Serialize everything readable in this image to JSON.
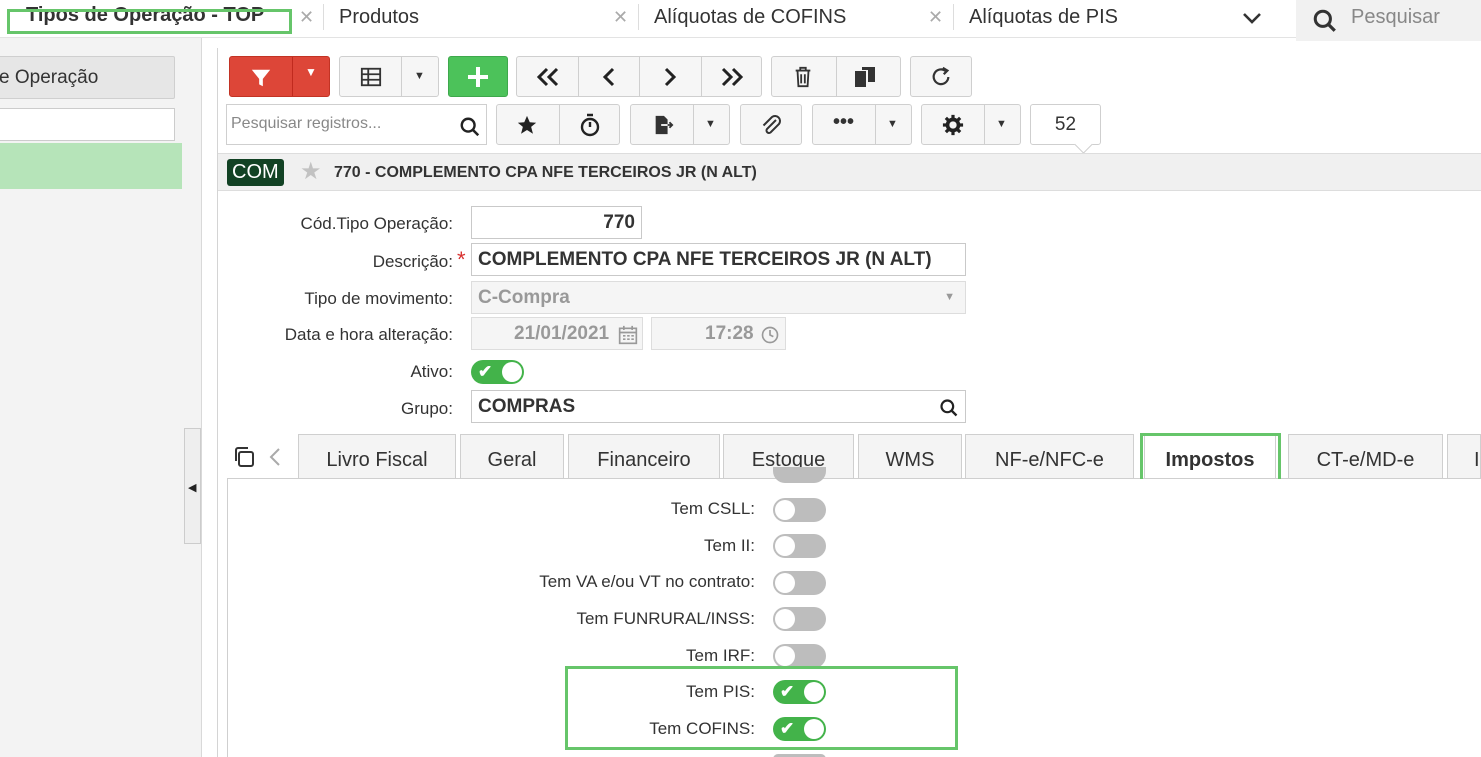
{
  "top_tabs": [
    {
      "label": "Tipos de Operação - TOP"
    },
    {
      "label": "Produtos"
    },
    {
      "label": "Alíquotas de COFINS"
    },
    {
      "label": "Alíquotas de PIS"
    }
  ],
  "top_search_placeholder": "Pesquisar",
  "sidebar": {
    "button_label": "e Operação"
  },
  "toolbar": {
    "search_placeholder": "Pesquisar registros...",
    "record_count": "52"
  },
  "record": {
    "badge": "COM",
    "title": "770 - COMPLEMENTO CPA NFE TERCEIROS JR (N ALT)"
  },
  "form": {
    "cod_label": "Cód.Tipo Operação:",
    "cod_value": "770",
    "desc_label": "Descrição:",
    "desc_value": "COMPLEMENTO CPA NFE TERCEIROS JR (N ALT)",
    "tipo_label": "Tipo de movimento:",
    "tipo_value": "C-Compra",
    "data_label": "Data e hora alteração:",
    "date_value": "21/01/2021",
    "time_value": "17:28",
    "ativo_label": "Ativo:",
    "grupo_label": "Grupo:",
    "grupo_value": "COMPRAS"
  },
  "form_tabs": [
    {
      "label": "Livro Fiscal"
    },
    {
      "label": "Geral"
    },
    {
      "label": "Financeiro"
    },
    {
      "label": "Estoque"
    },
    {
      "label": "WMS"
    },
    {
      "label": "NF-e/NFC-e"
    },
    {
      "label": "Impostos"
    },
    {
      "label": "CT-e/MD-e"
    },
    {
      "label": "I"
    }
  ],
  "taxes": [
    {
      "label": "Tem CSLL:",
      "on": false
    },
    {
      "label": "Tem II:",
      "on": false
    },
    {
      "label": "Tem VA e/ou VT no contrato:",
      "on": false
    },
    {
      "label": "Tem FUNRURAL/INSS:",
      "on": false
    },
    {
      "label": "Tem IRF:",
      "on": false
    },
    {
      "label": "Tem PIS:",
      "on": true
    },
    {
      "label": "Tem COFINS:",
      "on": true
    }
  ],
  "colors": {
    "accent_green": "#43b34a",
    "highlight_green": "#66c56a",
    "filter_red": "#dd4638",
    "badge_dark_green": "#124224"
  }
}
